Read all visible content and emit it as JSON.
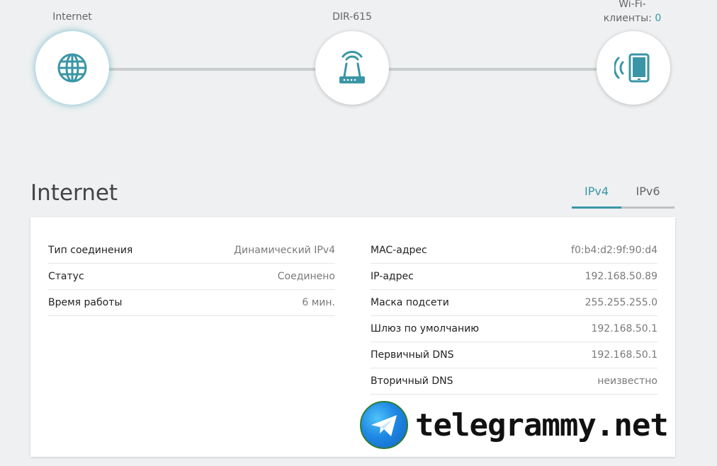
{
  "topology": {
    "internet": {
      "label": "Internet",
      "icon": "globe-icon"
    },
    "router": {
      "label": "DIR-615",
      "icon": "router-icon"
    },
    "wifi": {
      "label_line1": "Wi-Fi-",
      "label_line2": "клиенты: ",
      "count": "0",
      "icon": "wifi-tablet-icon"
    }
  },
  "section": {
    "title": "Internet",
    "tabs": [
      {
        "label": "IPv4",
        "active": true
      },
      {
        "label": "IPv6",
        "active": false
      }
    ]
  },
  "left_rows": [
    {
      "key": "Тип соединения",
      "value": "Динамический IPv4"
    },
    {
      "key": "Статус",
      "value": "Соединено"
    },
    {
      "key": "Время работы",
      "value": "6 мин."
    }
  ],
  "right_rows": [
    {
      "key": "MAC-адрес",
      "value": "f0:b4:d2:9f:90:d4"
    },
    {
      "key": "IP-адрес",
      "value": "192.168.50.89"
    },
    {
      "key": "Маска подсети",
      "value": "255.255.255.0"
    },
    {
      "key": "Шлюз по умолчанию",
      "value": "192.168.50.1"
    },
    {
      "key": "Первичный DNS",
      "value": "192.168.50.1"
    },
    {
      "key": "Вторичный DNS",
      "value": "неизвестно"
    }
  ],
  "watermark": {
    "text": "telegrammy.net"
  },
  "colors": {
    "accent": "#3a96a6",
    "background": "#eef0f1",
    "connector": "#c9cccd"
  }
}
